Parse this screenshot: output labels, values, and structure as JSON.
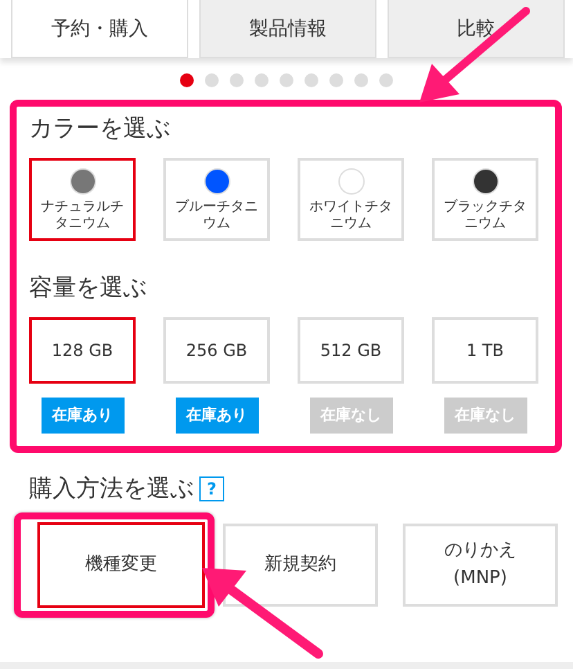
{
  "tabs": [
    {
      "label": "予約・購入",
      "selected": true
    },
    {
      "label": "製品情報",
      "selected": false
    },
    {
      "label": "比較",
      "selected": false
    }
  ],
  "carousel_dots": [
    {
      "selected": true
    },
    {
      "selected": false
    },
    {
      "selected": false
    },
    {
      "selected": false
    },
    {
      "selected": false
    },
    {
      "selected": false
    },
    {
      "selected": false
    },
    {
      "selected": false
    },
    {
      "selected": false
    }
  ],
  "color_section": {
    "heading": "カラーを選ぶ",
    "options": [
      {
        "label": "ナチュラルチタニウム",
        "color": "#777777",
        "selected": true
      },
      {
        "label": "ブルーチタニウム",
        "color": "#0055ff",
        "selected": false
      },
      {
        "label": "ホワイトチタニウム",
        "color": "#ffffff",
        "selected": false
      },
      {
        "label": "ブラックチタニウム",
        "color": "#333333",
        "selected": false
      }
    ]
  },
  "capacity_section": {
    "heading": "容量を選ぶ",
    "options": [
      {
        "label": "128 GB",
        "selected": true,
        "stock": "在庫あり",
        "in_stock": true
      },
      {
        "label": "256 GB",
        "selected": false,
        "stock": "在庫あり",
        "in_stock": true
      },
      {
        "label": "512 GB",
        "selected": false,
        "stock": "在庫なし",
        "in_stock": false
      },
      {
        "label": "1 TB",
        "selected": false,
        "stock": "在庫なし",
        "in_stock": false
      }
    ]
  },
  "purchase_section": {
    "heading": "購入方法を選ぶ",
    "help": "?",
    "options": [
      {
        "label": "機種変更",
        "selected": true
      },
      {
        "label": "新規契約",
        "selected": false
      },
      {
        "label": "のりかえ",
        "note": "(MNP)",
        "selected": false
      }
    ]
  }
}
